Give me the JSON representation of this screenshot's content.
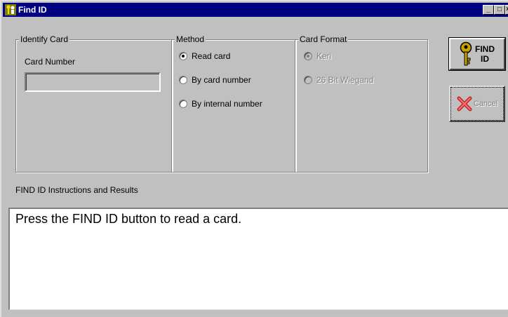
{
  "window": {
    "title": "Find ID",
    "controls": [
      "_",
      "□",
      "×"
    ]
  },
  "identify_card": {
    "legend": "Identify Card",
    "card_number_label": "Card Number",
    "card_number_value": ""
  },
  "method": {
    "legend": "Method",
    "options": [
      {
        "label": "Read card",
        "checked": true
      },
      {
        "label": "By card number",
        "checked": false
      },
      {
        "label": "By internal number",
        "checked": false
      }
    ]
  },
  "card_format": {
    "legend": "Card Format",
    "options": [
      {
        "label": "Keri",
        "checked": true,
        "disabled": true
      },
      {
        "label": "26 Bit Wiegand",
        "checked": false,
        "disabled": true
      }
    ]
  },
  "buttons": {
    "find_id_line1": "FIND",
    "find_id_line2": "ID",
    "cancel": "Cancel"
  },
  "results": {
    "heading": "FIND ID Instructions and Results",
    "text": "Press the FIND ID button to read a card."
  },
  "icons": {
    "title": "key-people-icon",
    "find": "key-icon",
    "cancel": "red-x-icon"
  },
  "colors": {
    "titlebar": "#000080",
    "face": "#c0c0c0",
    "disabled_text": "#808080",
    "cancel_x": "#cc2222",
    "key": "#c8a000"
  }
}
